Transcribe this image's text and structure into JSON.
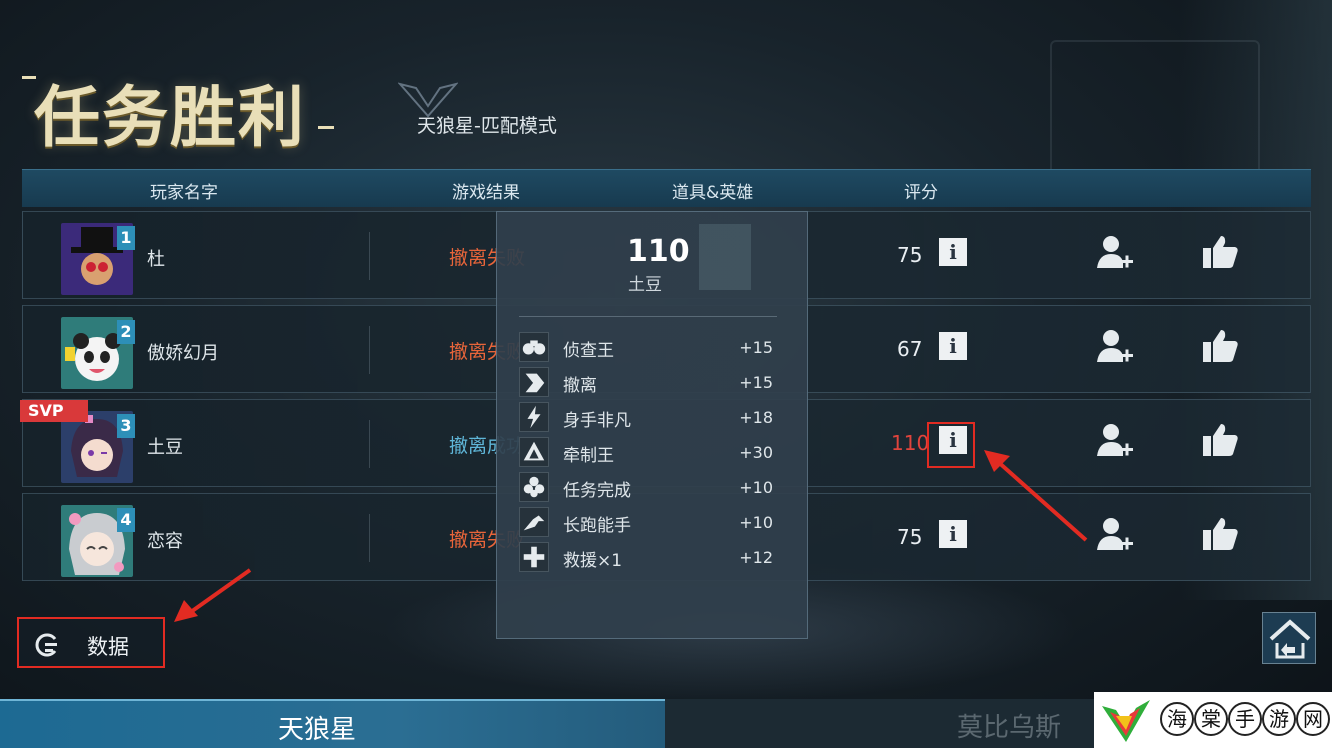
{
  "header": {
    "title": "任务胜利",
    "mode": "天狼星-匹配模式"
  },
  "columns": {
    "name": "玩家名字",
    "result": "游戏结果",
    "items": "道具&英雄",
    "score": "评分"
  },
  "players": [
    {
      "rank": "1",
      "name": "杜",
      "result": "撤离失败",
      "result_color": "#e8653a",
      "score": "75",
      "score_color": "#e9eef2"
    },
    {
      "rank": "2",
      "name": "傲娇幻月",
      "result": "撤离失败",
      "result_color": "#e8653a",
      "score": "67",
      "score_color": "#e9eef2"
    },
    {
      "rank": "3",
      "name": "土豆",
      "result": "撤离成功",
      "result_color": "#5fb6d8",
      "score": "110",
      "score_color": "#e0443c",
      "badge": "SVP"
    },
    {
      "rank": "4",
      "name": "恋容",
      "result": "撤离失败",
      "result_color": "#e8653a",
      "score": "75",
      "score_color": "#e9eef2"
    }
  ],
  "popup": {
    "score": "110",
    "name": "土豆",
    "achievements": [
      {
        "label": "侦查王",
        "points": "+15",
        "icon": "binoculars-icon"
      },
      {
        "label": "撤离",
        "points": "+15",
        "icon": "evacuate-icon"
      },
      {
        "label": "身手非凡",
        "points": "+18",
        "icon": "lightning-icon"
      },
      {
        "label": "牵制王",
        "points": "+30",
        "icon": "triangle-icon"
      },
      {
        "label": "任务完成",
        "points": "+10",
        "icon": "clover-icon"
      },
      {
        "label": "长跑能手",
        "points": "+10",
        "icon": "runner-icon"
      },
      {
        "label": "救援×1",
        "points": "+12",
        "icon": "plus-icon"
      }
    ]
  },
  "data_button": {
    "label": "数据"
  },
  "info_label": "i",
  "tabs": {
    "active": "天狼星",
    "inactive": "莫比乌斯"
  },
  "watermark": {
    "chars": [
      "海",
      "棠",
      "手",
      "游",
      "网"
    ]
  },
  "colors": {
    "accent": "#2d8fb8",
    "highlight": "#e22b22",
    "fail": "#e8653a",
    "success": "#5fb6d8"
  }
}
